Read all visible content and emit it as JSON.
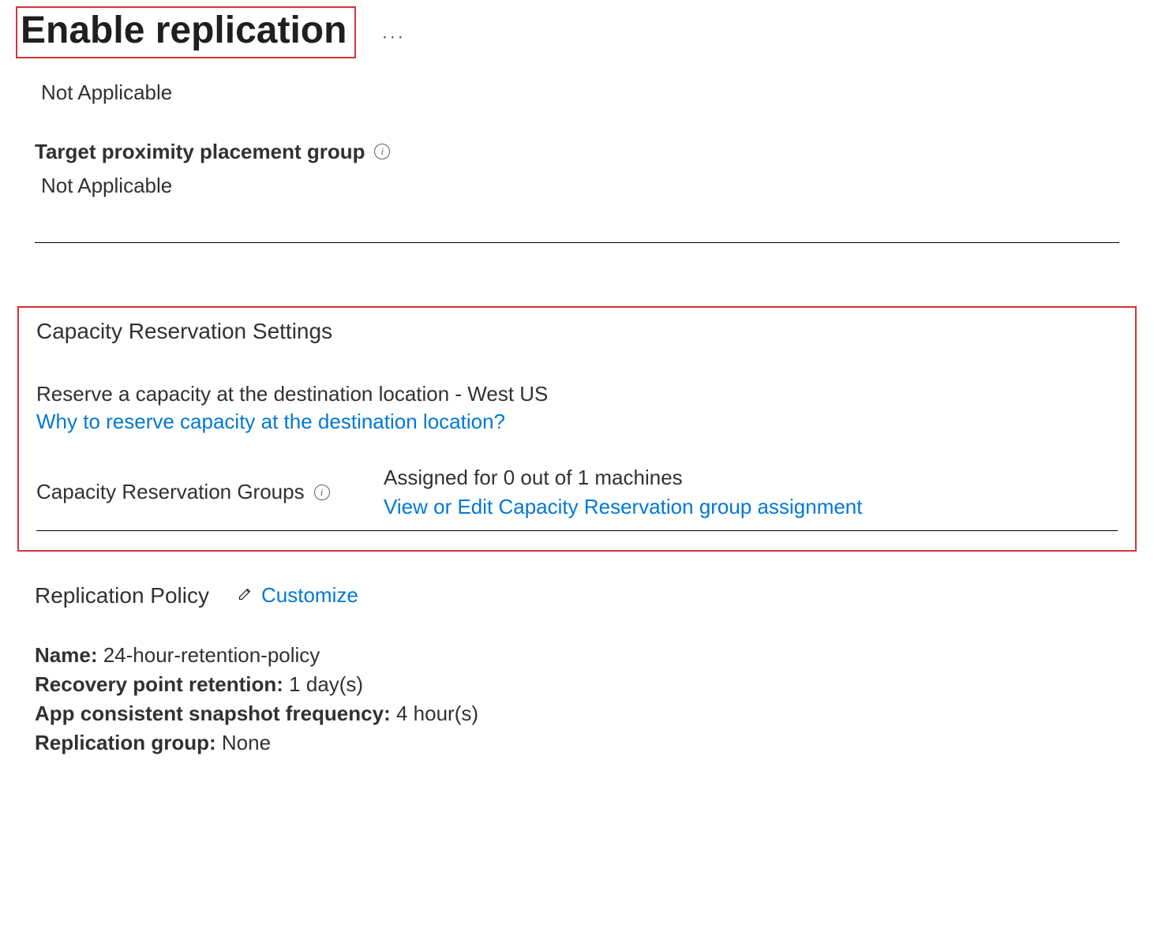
{
  "header": {
    "title": "Enable replication"
  },
  "truncated": {
    "value": "Not Applicable"
  },
  "proximity": {
    "label": "Target proximity placement group",
    "value": "Not Applicable"
  },
  "capacity": {
    "sectionTitle": "Capacity Reservation Settings",
    "description": "Reserve a capacity at the destination location - West US",
    "whyLink": "Why to reserve capacity at the destination location?",
    "groupsLabel": "Capacity Reservation Groups",
    "groupsValue": "Assigned for 0 out of 1 machines",
    "viewEditLink": "View or Edit Capacity Reservation group assignment"
  },
  "policy": {
    "title": "Replication Policy",
    "customizeLabel": "Customize",
    "name": {
      "label": "Name:",
      "value": "24-hour-retention-policy"
    },
    "retention": {
      "label": "Recovery point retention:",
      "value": "1 day(s)"
    },
    "snapshot": {
      "label": "App consistent snapshot frequency:",
      "value": "4 hour(s)"
    },
    "replicationGroup": {
      "label": "Replication group:",
      "value": "None"
    }
  }
}
